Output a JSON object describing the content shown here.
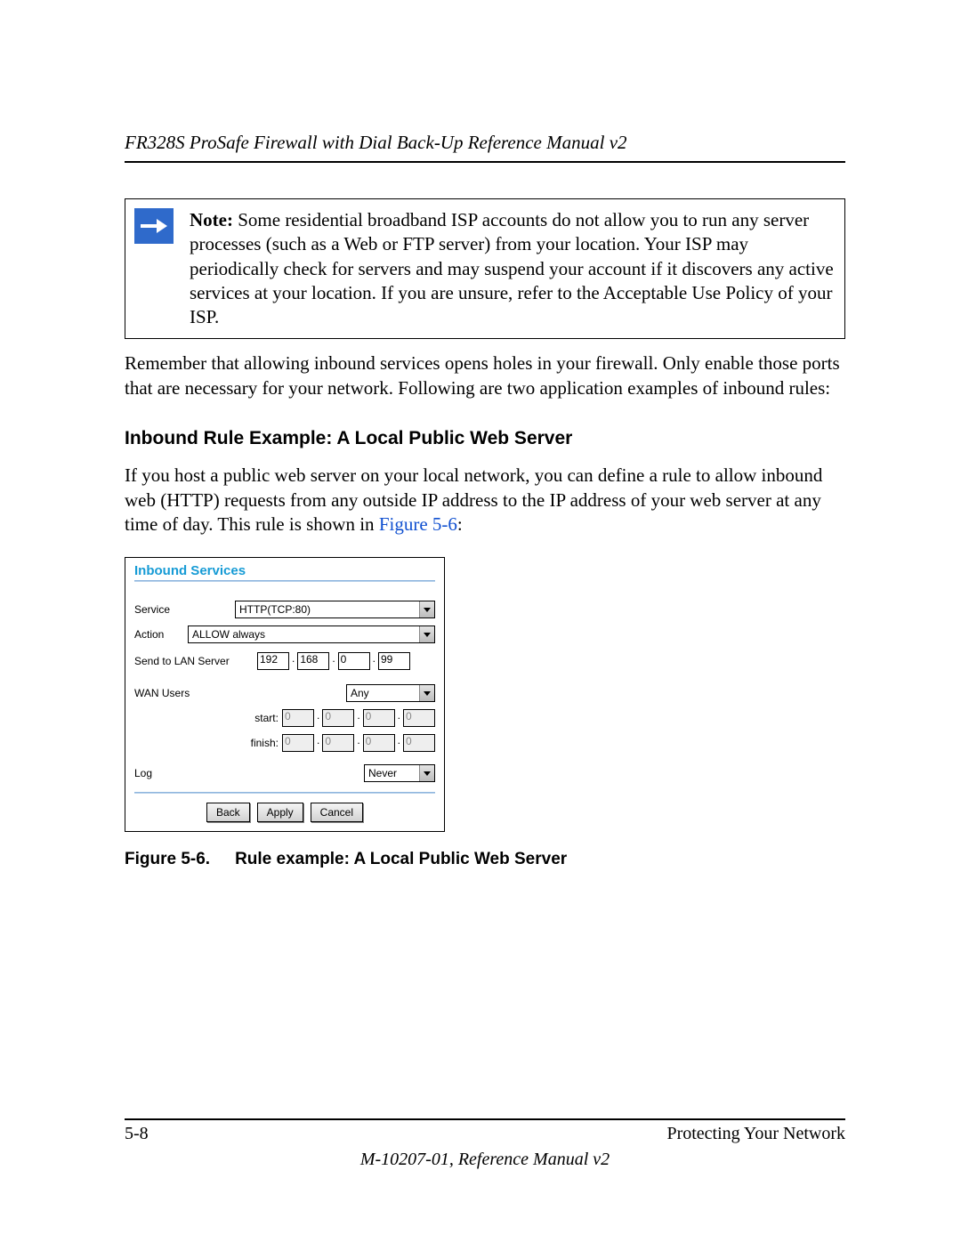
{
  "header": {
    "title": "FR328S ProSafe Firewall with Dial Back-Up Reference Manual v2"
  },
  "note": {
    "label": "Note:",
    "text": " Some residential broadband ISP accounts do not allow you to run any server processes (such as a Web or FTP server) from your location. Your ISP may periodically check for servers and may suspend your account if it discovers any active services at your location. If you are unsure, refer to the Acceptable Use Policy of your ISP."
  },
  "para1": "Remember that allowing inbound services opens holes in your firewall. Only enable those ports that are necessary for your network. Following are two application examples of inbound rules:",
  "section_heading": "Inbound Rule Example: A Local Public Web Server",
  "para2_a": "If you host a public web server on your local network, you can define a rule to allow inbound web (HTTP) requests from any outside IP address to the IP address of your web server at any time of day. This rule is shown in ",
  "para2_link": "Figure 5-6",
  "para2_b": ":",
  "panel": {
    "title": "Inbound Services",
    "labels": {
      "service": "Service",
      "action": "Action",
      "send_to": "Send to LAN Server",
      "wan_users": "WAN Users",
      "start": "start:",
      "finish": "finish:",
      "log": "Log"
    },
    "values": {
      "service": "HTTP(TCP:80)",
      "action": "ALLOW always",
      "send_to_ip": [
        "192",
        "168",
        "0",
        "99"
      ],
      "wan_users": "Any",
      "start_ip": [
        "0",
        "0",
        "0",
        "0"
      ],
      "finish_ip": [
        "0",
        "0",
        "0",
        "0"
      ],
      "log": "Never"
    },
    "buttons": {
      "back": "Back",
      "apply": "Apply",
      "cancel": "Cancel"
    }
  },
  "figure_caption": {
    "num": "Figure 5-6.",
    "text": "Rule example: A Local Public Web Server"
  },
  "footer": {
    "page": "5-8",
    "right": "Protecting Your Network",
    "center": "M-10207-01, Reference Manual v2"
  }
}
